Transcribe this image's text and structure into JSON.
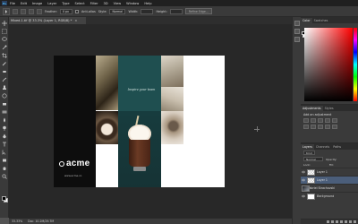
{
  "menu": [
    "File",
    "Edit",
    "Image",
    "Layer",
    "Type",
    "Select",
    "Filter",
    "3D",
    "View",
    "Window",
    "Help"
  ],
  "options": {
    "feather_label": "Feather:",
    "feather_value": "0 px",
    "antialias_label": "Anti-alias",
    "style_label": "Style:",
    "style_value": "Normal",
    "width_label": "Width:",
    "height_label": "Height:",
    "refine_label": "Refine Edge..."
  },
  "document": {
    "tab_title": "Mixed-1.tif @ 33.3% (Layer 1, RGB/8) *",
    "status_zoom": "33.33%",
    "status_doc": "Doc: 10.2M/29.7M"
  },
  "artwork": {
    "tagline": "Inspire your team",
    "logo": "acme",
    "url": "www.acme.co"
  },
  "colors": {
    "foreground": "#000000",
    "background": "#ffffff"
  },
  "panels": {
    "color_tab": "Color",
    "swatches_tab": "Swatches",
    "adjustments_tab": "Adjustments",
    "styles_tab": "Styles",
    "adjust_title": "Add an adjustment",
    "layers_tab": "Layers",
    "channels_tab": "Channels",
    "paths_tab": "Paths",
    "kind_label": "Kind",
    "blend_mode": "Normal",
    "opacity_label": "Opacity:",
    "lock_label": "Lock:",
    "fill_label": "Fill:"
  },
  "layers": [
    {
      "name": "Layer 1",
      "thumb": "checker",
      "selected": false,
      "italic": false
    },
    {
      "name": "Layer 1",
      "thumb": "checker",
      "selected": true,
      "italic": false
    },
    {
      "name": "Gabriel Strachovski",
      "thumb": "photo",
      "selected": false,
      "italic": false
    },
    {
      "name": "Background",
      "thumb": "white",
      "selected": false,
      "italic": true
    }
  ]
}
